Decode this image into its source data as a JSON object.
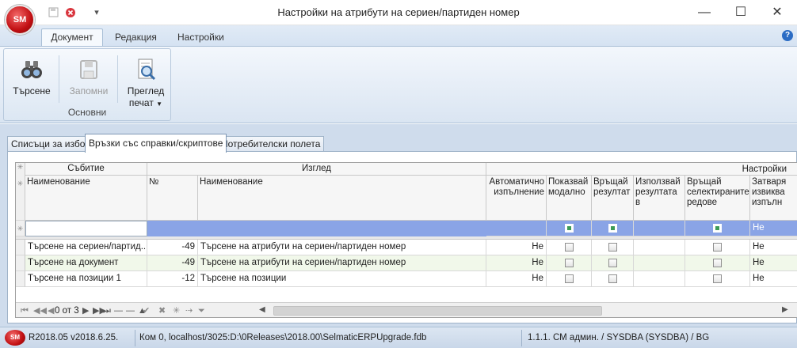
{
  "app": {
    "logo": "SM",
    "title": "Настройки на атрибути на сериен/партиден номер",
    "quick_access": [
      "save-icon",
      "close-circle-icon",
      "dropdown-icon"
    ]
  },
  "window_buttons": {
    "minimize": "—",
    "maximize": "☐",
    "close": "✕"
  },
  "ribbon": {
    "tabs": [
      "Документ",
      "Редакция",
      "Настройки"
    ],
    "active_tab": "Документ",
    "group": {
      "label": "Основни",
      "buttons": [
        {
          "label": "Търсене",
          "icon": "binoculars-icon",
          "enabled": true
        },
        {
          "label": "Запомни",
          "icon": "save-icon",
          "enabled": false
        },
        {
          "label": "Преглед",
          "label2": "печат",
          "icon": "print-preview-icon",
          "enabled": true
        }
      ]
    }
  },
  "page_tabs": [
    "Списъци за избор",
    "Връзки със справки/скриптове",
    "Потребителски полета"
  ],
  "grid": {
    "bands": {
      "event": "Събитие",
      "view": "Изглед",
      "settings": "Настройки"
    },
    "columns": {
      "event_name": "Наименование",
      "no": "№",
      "view_name": "Наименование",
      "auto": "Автоматично изпълнение",
      "modal": "Показвай модално",
      "ret": "Връщай резултат",
      "use": "Използвай резултата в",
      "sel": "Връщай селектираните редове",
      "close": "Затваря извиква изпълн"
    },
    "new_row": {
      "auto": "",
      "close": "Не"
    },
    "rows": [
      {
        "event": "Търсене на сериен/партид...",
        "no": "-49",
        "view": "Търсене на атрибути на сериен/партиден номер",
        "auto": "Не",
        "close": "Не"
      },
      {
        "event": "Търсене на документ",
        "no": "-49",
        "view": "Търсене на атрибути на сериен/партиден номер",
        "auto": "Не",
        "close": "Не"
      },
      {
        "event": "Търсене на позиции 1",
        "no": "-12",
        "view": "Търсене на позиции",
        "auto": "Не",
        "close": "Не"
      }
    ],
    "navigator": {
      "record_text": "0 от 3"
    }
  },
  "status": {
    "logo": "SM",
    "version": "R2018.05 v2018.6.25.",
    "connection": "Ком 0, localhost/3025:D:\\0Releases\\2018.00\\SelmaticERPUpgrade.fdb",
    "user": "1.1.1. СМ админ. / SYSDBA (SYSDBA) / BG"
  },
  "colors": {
    "accent": "#2b579a",
    "selected_row": "#8aa4e6",
    "ribbon_bg": "#dae5f2"
  }
}
